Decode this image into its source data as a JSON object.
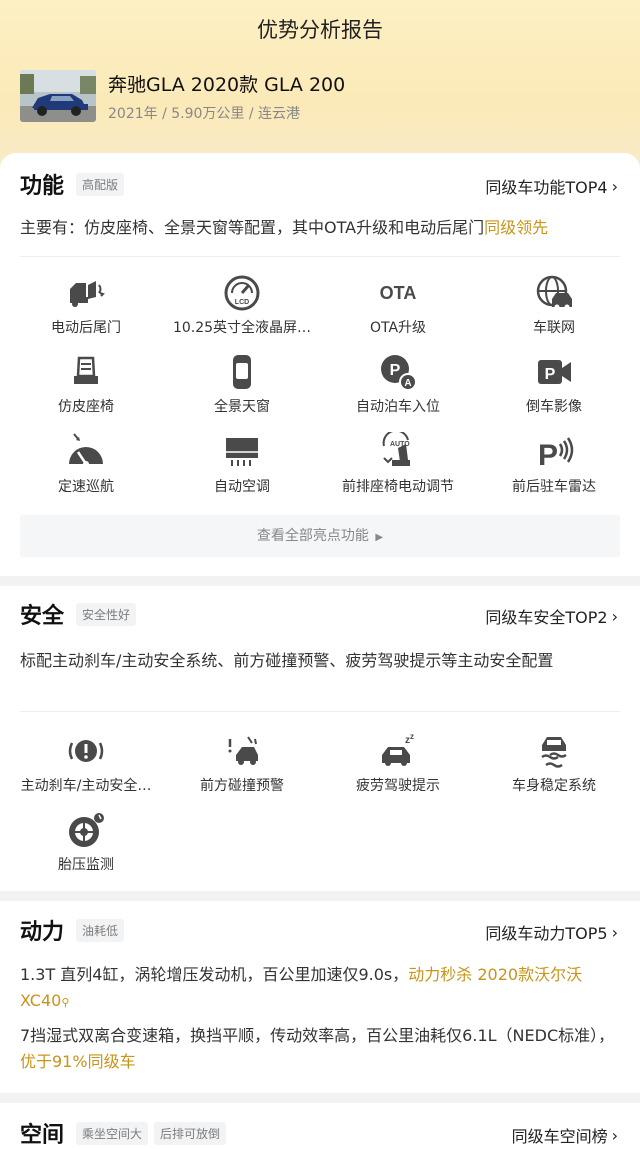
{
  "header": {
    "title": "优势分析报告",
    "car_name": "奔驰GLA 2020款 GLA 200",
    "car_meta": "2021年 / 5.90万公里 / 连云港"
  },
  "function": {
    "title": "功能",
    "tag": "高配版",
    "top_link": "同级车功能TOP4",
    "desc_prefix": "主要有：仿皮座椅、全景天窗等配置，其中OTA升级和电动后尾门",
    "desc_highlight": "同级领先",
    "features": [
      {
        "label": "电动后尾门",
        "icon": "power-tailgate-icon"
      },
      {
        "label": "10.25英寸全液晶屏…",
        "icon": "lcd-gauge-icon"
      },
      {
        "label": "OTA升级",
        "icon": "ota-icon",
        "icon_text": "OTA"
      },
      {
        "label": "车联网",
        "icon": "connected-car-icon"
      },
      {
        "label": "仿皮座椅",
        "icon": "leather-seat-icon"
      },
      {
        "label": "全景天窗",
        "icon": "panoramic-roof-icon"
      },
      {
        "label": "自动泊车入位",
        "icon": "auto-parking-icon"
      },
      {
        "label": "倒车影像",
        "icon": "reverse-camera-icon"
      },
      {
        "label": "定速巡航",
        "icon": "cruise-control-icon"
      },
      {
        "label": "自动空调",
        "icon": "auto-ac-icon"
      },
      {
        "label": "前排座椅电动调节",
        "icon": "power-seat-icon",
        "icon_text": "AUTO"
      },
      {
        "label": "前后驻车雷达",
        "icon": "parking-radar-icon"
      }
    ],
    "view_all": "查看全部亮点功能"
  },
  "safety": {
    "title": "安全",
    "tag": "安全性好",
    "top_link": "同级车安全TOP2",
    "desc": "标配主动刹车/主动安全系统、前方碰撞预警、疲劳驾驶提示等主动安全配置",
    "features": [
      {
        "label": "主动刹车/主动安全…",
        "icon": "active-brake-icon"
      },
      {
        "label": "前方碰撞预警",
        "icon": "collision-warning-icon"
      },
      {
        "label": "疲劳驾驶提示",
        "icon": "fatigue-alert-icon"
      },
      {
        "label": "车身稳定系统",
        "icon": "stability-control-icon"
      },
      {
        "label": "胎压监测",
        "icon": "tire-pressure-icon"
      }
    ]
  },
  "power": {
    "title": "动力",
    "tag": "油耗低",
    "top_link": "同级车动力TOP5",
    "desc1_prefix": "1.3T 直列4缸，涡轮增压发动机，百公里加速仅9.0s，",
    "desc1_highlight": "动力秒杀 2020款沃尔沃XC40",
    "desc2_prefix": "7挡湿式双离合变速箱，换挡平顺，传动效率高，百公里油耗仅6.1L（NEDC标准），",
    "desc2_highlight": "优于91%同级车"
  },
  "space": {
    "title": "空间",
    "tag1": "乘坐空间大",
    "tag2": "后排可放倒",
    "top_link": "同级车空间榜"
  },
  "colors": {
    "accent": "#c89419",
    "header_bg": "#fbe9b8",
    "icon": "#4a4a4a"
  }
}
